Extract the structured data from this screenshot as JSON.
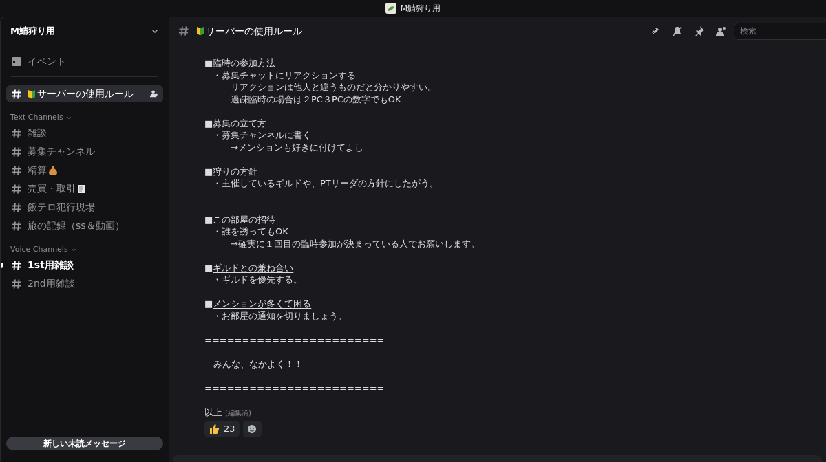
{
  "window": {
    "title": "M鯖狩り用"
  },
  "sidebar": {
    "server_name": "M鯖狩り用",
    "events_label": "イベント",
    "pinned_channel": {
      "name": "サーバーの使用ルール",
      "selected": true
    },
    "categories": [
      {
        "label": "Text Channels",
        "channels": [
          {
            "name": "雑談",
            "selected": false,
            "unread": false
          },
          {
            "name": "募集チャンネル",
            "selected": false,
            "unread": false
          },
          {
            "name": "精算",
            "selected": false,
            "unread": false,
            "kind": "bag"
          },
          {
            "name": "売買・取引",
            "selected": false,
            "unread": false,
            "kind": "receipt"
          },
          {
            "name": "飯テロ犯行現場",
            "selected": false,
            "unread": false
          },
          {
            "name": "旅の記録（ss＆動画）",
            "selected": false,
            "unread": false
          }
        ]
      },
      {
        "label": "Voice Channels",
        "channels": [
          {
            "name": "1st用雑談",
            "selected": false,
            "unread": true
          },
          {
            "name": "2nd用雑談",
            "selected": false,
            "unread": false
          }
        ]
      }
    ],
    "new_messages_button": "新しい未読メッセージ"
  },
  "channel_header": {
    "title": "サーバーの使用ルール",
    "search": {
      "placeholder": "検索"
    }
  },
  "message": {
    "lines": [
      {
        "kind": "heading",
        "mark": "■",
        "text": "臨時の参加方法",
        "underlined": false
      },
      {
        "kind": "bullet",
        "mark": "・",
        "text": "募集チャットにリアクションする",
        "underlined": true
      },
      {
        "kind": "note",
        "text": "リアクションは他人と違うものだと分かりやすい。"
      },
      {
        "kind": "note",
        "text": "過疎臨時の場合は２PC３PCの数字でもOK"
      },
      {
        "kind": "spacer"
      },
      {
        "kind": "heading",
        "mark": "■",
        "text": "募集の立て方",
        "underlined": false
      },
      {
        "kind": "bullet",
        "mark": "・",
        "text": "募集チャンネルに書く",
        "underlined": true
      },
      {
        "kind": "note",
        "text": "→メンションも好きに付けてよし"
      },
      {
        "kind": "spacer"
      },
      {
        "kind": "heading",
        "mark": "■",
        "text": "狩りの方針",
        "underlined": false
      },
      {
        "kind": "bullet",
        "mark": "・",
        "text": "主催しているギルドや、PTリーダの方針にしたがう。",
        "underlined": true
      },
      {
        "kind": "spacer"
      },
      {
        "kind": "spacer"
      },
      {
        "kind": "heading",
        "mark": "■",
        "text": "この部屋の招待",
        "underlined": false
      },
      {
        "kind": "bullet",
        "mark": "・",
        "text": "誰を誘ってもOK",
        "underlined": true
      },
      {
        "kind": "note",
        "text": "→確実に１回目の臨時参加が決まっている人でお願いします。"
      },
      {
        "kind": "spacer"
      },
      {
        "kind": "heading",
        "mark": "■",
        "text": "ギルドとの兼ね合い",
        "underlined": true
      },
      {
        "kind": "bullet",
        "mark": "・",
        "text": "ギルドを優先する。",
        "underlined": false
      },
      {
        "kind": "spacer"
      },
      {
        "kind": "heading",
        "mark": "■",
        "text": "メンションが多くて困る",
        "underlined": true
      },
      {
        "kind": "bullet",
        "mark": "・",
        "text": "お部屋の通知を切りましょう。",
        "underlined": false
      },
      {
        "kind": "spacer"
      },
      {
        "kind": "plain",
        "text": "========================"
      },
      {
        "kind": "spacer"
      },
      {
        "kind": "plain",
        "text": "　みんな、なかよく！！"
      },
      {
        "kind": "spacer"
      },
      {
        "kind": "plain",
        "text": "========================"
      },
      {
        "kind": "spacer"
      },
      {
        "kind": "last",
        "text": "以上",
        "edited": "(編集済)"
      }
    ],
    "reactions": [
      {
        "count": "23"
      }
    ]
  }
}
